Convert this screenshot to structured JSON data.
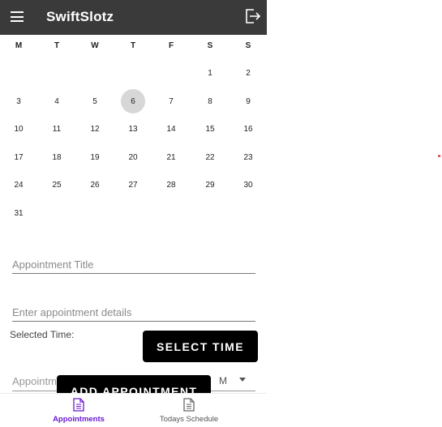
{
  "app": {
    "title": "SwiftSlotz"
  },
  "calendar": {
    "weekdays": [
      "M",
      "T",
      "W",
      "T",
      "F",
      "S",
      "S"
    ],
    "weeks": [
      [
        "",
        "",
        "",
        "",
        "",
        "1",
        "2"
      ],
      [
        "3",
        "4",
        "5",
        "6",
        "7",
        "8",
        "9"
      ],
      [
        "10",
        "11",
        "12",
        "13",
        "14",
        "15",
        "16"
      ],
      [
        "17",
        "18",
        "19",
        "20",
        "21",
        "22",
        "23"
      ],
      [
        "24",
        "25",
        "26",
        "27",
        "28",
        "29",
        "30"
      ],
      [
        "31",
        "",
        "",
        "",
        "",
        "",
        ""
      ]
    ],
    "selected_day": "6"
  },
  "form": {
    "title_placeholder": "Appointment Title",
    "details_placeholder": "Enter appointment details",
    "selected_time_label": "Selected Time:",
    "select_time_button": "SELECT TIME",
    "type_placeholder": "Appointm",
    "type_value": "M",
    "add_button": "ADD APPOINTMENT"
  },
  "bottom_nav": {
    "items": [
      {
        "label": "Appointments",
        "icon": "document-icon",
        "active": true
      },
      {
        "label": "Todays Schedule",
        "icon": "document-icon",
        "active": false
      }
    ]
  },
  "colors": {
    "appbar": "#3a3a3a",
    "accent": "#6a1bd1",
    "button": "#000000"
  }
}
